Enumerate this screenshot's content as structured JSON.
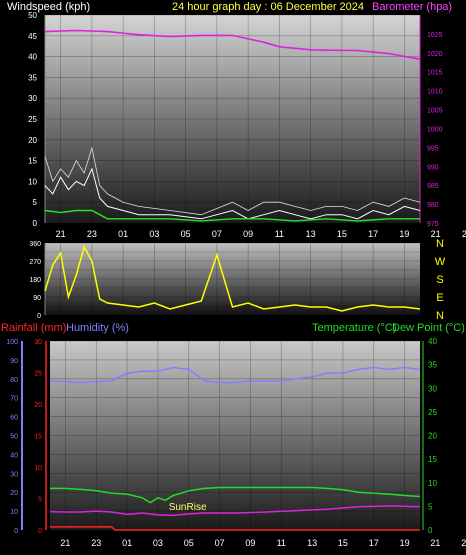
{
  "header": {
    "wind_title": "Windspeed (kph)",
    "main_title": "24 hour graph day : 06 December 2024",
    "baro_title": "Barometer (hpa)"
  },
  "colors": {
    "windspeed": "#ffffff",
    "gust": "#e0e0e0",
    "wind_avg": "#22e822",
    "barometer": "#dd22dd",
    "direction": "#ffff00",
    "rain": "#ff2222",
    "humidity": "#8080ff",
    "temperature": "#22dd22",
    "dewpoint": "#dd22dd",
    "sunrise_label": "#ffff66"
  },
  "x_ticks": [
    "21",
    "23",
    "01",
    "03",
    "05",
    "07",
    "09",
    "11",
    "13",
    "15",
    "17",
    "19",
    "21",
    "23"
  ],
  "chart_data": [
    {
      "type": "line",
      "id": "wind-baro",
      "title": "24 hour graph day : 06 December 2024",
      "ylabel_left": "Windspeed (kph)",
      "ylabel_right": "Barometer (hpa)",
      "y_left_ticks": [
        "0",
        "5",
        "10",
        "15",
        "20",
        "25",
        "30",
        "35",
        "40",
        "45",
        "50"
      ],
      "y_left_range": [
        0,
        50
      ],
      "y_right_ticks": [
        "975",
        "980",
        "985",
        "990",
        "995",
        "1000",
        "1005",
        "1010",
        "1015",
        "1020",
        "1025"
      ],
      "y_right_range": [
        975,
        1030
      ],
      "series": [
        {
          "name": "Barometer (hpa)",
          "axis": "right",
          "x": [
            0,
            2,
            4,
            6,
            8,
            10,
            12,
            14,
            15,
            16,
            17,
            18,
            20,
            22,
            24
          ],
          "y": [
            1025.6,
            1025.9,
            1025.6,
            1024.8,
            1024.3,
            1024.6,
            1024.6,
            1022.8,
            1021.6,
            1021.2,
            1020.8,
            1020.7,
            1020.6,
            1019.8,
            1018.3
          ]
        },
        {
          "name": "Windspeed (kph)",
          "axis": "left",
          "x": [
            0,
            0.5,
            1,
            1.5,
            2,
            2.5,
            3,
            3.5,
            4,
            5,
            6,
            8,
            10,
            12,
            13,
            14,
            15,
            16,
            17,
            18,
            19,
            20,
            21,
            22,
            23,
            24
          ],
          "y": [
            9,
            7,
            11,
            8,
            10,
            9,
            13,
            6,
            4,
            3,
            2,
            2,
            1,
            3,
            1,
            2,
            3,
            2,
            1,
            2,
            2,
            1,
            3,
            2,
            4,
            3
          ]
        },
        {
          "name": "Gust (kph)",
          "axis": "left",
          "x": [
            0,
            0.5,
            1,
            1.5,
            2,
            2.5,
            3,
            3.5,
            4,
            5,
            6,
            8,
            10,
            12,
            13,
            14,
            15,
            16,
            17,
            18,
            19,
            20,
            21,
            22,
            23,
            24
          ],
          "y": [
            16,
            10,
            13,
            11,
            15,
            12,
            18,
            9,
            7,
            5,
            4,
            3,
            2,
            5,
            3,
            5,
            5,
            4,
            3,
            4,
            4,
            3,
            5,
            4,
            6,
            5
          ]
        },
        {
          "name": "Average wind (kph)",
          "axis": "left",
          "x": [
            0,
            1,
            2,
            3,
            4,
            5,
            6,
            8,
            10,
            12,
            14,
            16,
            18,
            20,
            22,
            24
          ],
          "y": [
            3,
            2.5,
            3,
            3,
            1,
            1,
            1,
            1,
            0.5,
            1,
            1,
            0.5,
            1,
            0.5,
            1,
            1
          ]
        }
      ]
    },
    {
      "type": "scatter",
      "id": "direction",
      "ylabel_right": [
        "N",
        "W",
        "S",
        "E",
        "N"
      ],
      "y_ticks": [
        "0",
        "45",
        "90",
        "135",
        "180",
        "225",
        "270",
        "315",
        "360"
      ],
      "y_range": [
        0,
        360
      ],
      "series": [
        {
          "name": "Wind direction (deg)",
          "x": [
            0,
            0.5,
            1,
            1.5,
            2,
            2.5,
            3,
            3.5,
            4,
            5,
            6,
            7,
            8,
            9,
            10,
            11,
            12,
            13,
            14,
            15,
            16,
            17,
            18,
            19,
            20,
            21,
            22,
            23,
            24
          ],
          "y": [
            120,
            250,
            310,
            90,
            200,
            340,
            270,
            80,
            60,
            50,
            40,
            60,
            30,
            50,
            70,
            300,
            40,
            60,
            30,
            40,
            50,
            40,
            40,
            20,
            40,
            50,
            40,
            40,
            30
          ]
        }
      ]
    },
    {
      "type": "line",
      "id": "temp-hum-rain",
      "ylabel_left": [
        "Rainfall (mm)",
        "Humidity (%)"
      ],
      "ylabel_right": [
        "Temperature (°C)",
        "Dew Point (°C)"
      ],
      "humidity_ticks": [
        "0",
        "10",
        "20",
        "30",
        "40",
        "50",
        "60",
        "70",
        "80",
        "90",
        "100"
      ],
      "humidity_range": [
        0,
        100
      ],
      "rain_ticks": [
        "0",
        "5",
        "10",
        "15",
        "20",
        "25",
        "30"
      ],
      "rain_range": [
        0,
        30
      ],
      "temp_ticks": [
        "0",
        "5",
        "10",
        "15",
        "20",
        "25",
        "30",
        "35",
        "40"
      ],
      "temp_range": [
        0,
        40
      ],
      "annotations": [
        {
          "text": "SunRise",
          "x": 7.7
        }
      ],
      "series": [
        {
          "name": "Humidity (%)",
          "axis": "humidity",
          "x": [
            0,
            2,
            4,
            5,
            6,
            7,
            8,
            9,
            10,
            11,
            12,
            13,
            14,
            15,
            16,
            17,
            18,
            19,
            20,
            21,
            22,
            23,
            24
          ],
          "y": [
            79,
            78,
            79,
            83,
            84,
            84,
            86,
            85,
            79,
            78,
            78,
            79,
            79,
            79,
            80,
            81,
            83,
            83,
            85,
            86,
            85,
            86,
            85
          ]
        },
        {
          "name": "Temperature (°C)",
          "axis": "temp",
          "x": [
            0,
            1,
            2,
            3,
            4,
            5,
            6,
            6.5,
            7,
            7.5,
            8,
            9,
            10,
            11,
            12,
            13,
            14,
            15,
            16,
            17,
            18,
            19,
            20,
            21,
            22,
            23,
            24
          ],
          "y": [
            8.8,
            8.8,
            8.6,
            8.3,
            7.8,
            7.6,
            6.8,
            5.8,
            6.8,
            6.3,
            7.3,
            8.3,
            8.8,
            9.0,
            9.0,
            9.0,
            9.0,
            9.0,
            9.0,
            9.0,
            8.8,
            8.5,
            8.0,
            7.8,
            7.6,
            7.3,
            7.1
          ]
        },
        {
          "name": "Dew Point (°C)",
          "axis": "temp",
          "x": [
            0,
            1,
            2,
            3,
            4,
            5,
            6,
            7,
            8,
            9,
            10,
            11,
            12,
            14,
            16,
            18,
            20,
            22,
            24
          ],
          "y": [
            3.9,
            3.8,
            3.8,
            4.0,
            3.8,
            3.3,
            3.6,
            3.2,
            3.1,
            3.4,
            3.6,
            3.6,
            3.6,
            3.8,
            4.1,
            4.4,
            4.9,
            5.1,
            4.9
          ]
        },
        {
          "name": "Rainfall (mm)",
          "axis": "rain",
          "x": [
            0,
            1,
            2,
            3,
            4,
            4.2,
            24
          ],
          "y": [
            0.5,
            0.5,
            0.5,
            0.5,
            0.5,
            0,
            0
          ]
        }
      ]
    }
  ]
}
